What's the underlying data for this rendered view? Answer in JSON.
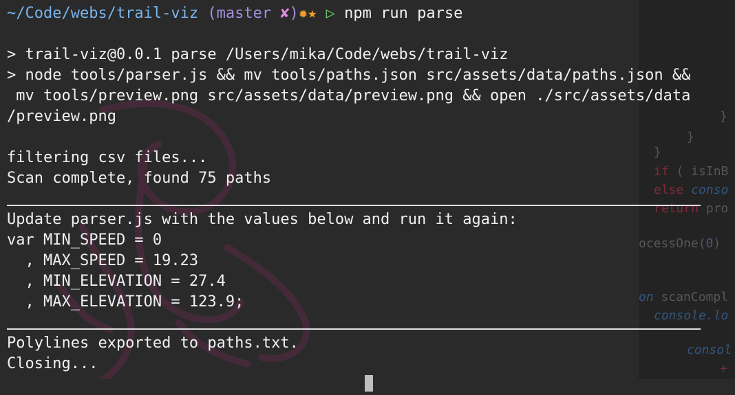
{
  "prompt": {
    "path": "~/Code/webs/trail-viz",
    "git_open": "(",
    "git_branch": "master",
    "git_dirty_icon": "✘",
    "git_close": ")",
    "status_icons": "✹★",
    "arrow": "▷",
    "command": "npm run parse"
  },
  "output": {
    "script_header": "> trail-viz@0.0.1 parse /Users/mika/Code/webs/trail-viz",
    "script_cmd_1": "> node tools/parser.js && mv tools/paths.json src/assets/data/paths.json &&",
    "script_cmd_2": " mv tools/preview.png src/assets/data/preview.png && open ./src/assets/data",
    "script_cmd_3": "/preview.png",
    "filtering": "filtering csv files...",
    "scan": "Scan complete, found 75 paths",
    "update_msg": "Update parser.js with the values below and run it again:",
    "var_min_speed": "var MIN_SPEED = 0",
    "var_max_speed": "  , MAX_SPEED = 19.23",
    "var_min_elev": "  , MIN_ELEVATION = 27.4",
    "var_max_elev": "  , MAX_ELEVATION = 123.9;",
    "exported": "Polylines exported to paths.txt.",
    "closing": "Closing..."
  },
  "background_code": {
    "brace1": "}",
    "brace2": "}",
    "brace3": "}",
    "if_kw": "if",
    "if_rest": " ( isInB",
    "else_kw": "else",
    "else_rest": " conso",
    "return_kw": "return",
    "return_rest": " pro",
    "process": "ocessOne(",
    "process_num": "0",
    "process_end": ")",
    "on_kw": "on",
    "scan_fn": " scanCompl",
    "console1": "console.lo",
    "console2": "consol",
    "plus": "+"
  },
  "colors": {
    "terminal_bg": "#2a2a2a",
    "path": "#7ab3ea",
    "git_branch": "#a390dd",
    "arrow": "#6ad46a"
  }
}
